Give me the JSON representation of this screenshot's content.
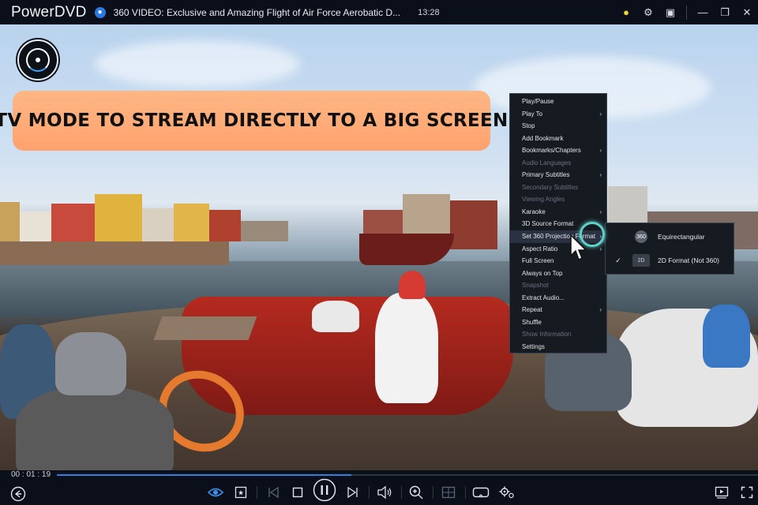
{
  "titlebar": {
    "app_name": "PowerDVD",
    "video_title": "360 VIDEO: Exclusive and Amazing Flight of Air Force Aerobatic D...",
    "clock": "13:28",
    "icons": [
      "bulb-icon",
      "gear-icon",
      "tv-mode-icon",
      "minimize-icon",
      "restore-icon",
      "close-icon"
    ]
  },
  "banner": {
    "text": "TV MODE TO STREAM DIRECTLY TO A BIG SCREEN"
  },
  "context_menu": {
    "items": [
      {
        "label": "Play/Pause",
        "submenu": false,
        "disabled": false
      },
      {
        "label": "Play To",
        "submenu": true,
        "disabled": false
      },
      {
        "label": "Stop",
        "submenu": false,
        "disabled": false
      },
      {
        "label": "Add Bookmark",
        "submenu": false,
        "disabled": false
      },
      {
        "label": "Bookmarks/Chapters",
        "submenu": true,
        "disabled": false
      },
      {
        "label": "Audio Languages",
        "submenu": false,
        "disabled": true
      },
      {
        "label": "Primary Subtitles",
        "submenu": true,
        "disabled": false
      },
      {
        "label": "Secondary Subtitles",
        "submenu": false,
        "disabled": true
      },
      {
        "label": "Viewing Angles",
        "submenu": false,
        "disabled": true
      },
      {
        "label": "Karaoke",
        "submenu": true,
        "disabled": false
      },
      {
        "label": "3D Source Format",
        "submenu": false,
        "disabled": false
      },
      {
        "label": "Set 360 Projection Format",
        "submenu": true,
        "disabled": false,
        "highlighted": true
      },
      {
        "label": "Aspect Ratio",
        "submenu": true,
        "disabled": false
      },
      {
        "label": "Full Screen",
        "submenu": false,
        "disabled": false
      },
      {
        "label": "Always on Top",
        "submenu": false,
        "disabled": false
      },
      {
        "label": "Snapshot",
        "submenu": false,
        "disabled": true
      },
      {
        "label": "Extract Audio...",
        "submenu": false,
        "disabled": false
      },
      {
        "label": "Repeat",
        "submenu": true,
        "disabled": false
      },
      {
        "label": "Shuffle",
        "submenu": false,
        "disabled": false
      },
      {
        "label": "Show Information",
        "submenu": false,
        "disabled": true
      },
      {
        "label": "Settings",
        "submenu": false,
        "disabled": false
      }
    ]
  },
  "projection_submenu": {
    "items": [
      {
        "icon_label": "360",
        "label": "Equirectangular",
        "checked": false
      },
      {
        "icon_label": "2D",
        "label": "2D Format (Not 360)",
        "checked": true
      }
    ]
  },
  "controls": {
    "elapsed": "00 : 01 : 19",
    "progress_fraction": 0.42
  }
}
